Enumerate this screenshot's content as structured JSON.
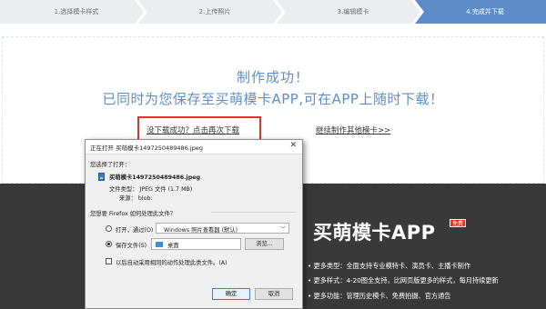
{
  "steps": [
    {
      "label": "1.选择模卡样式"
    },
    {
      "label": "2.上传照片"
    },
    {
      "label": "3.编辑模卡"
    },
    {
      "label": "4.完成并下载"
    }
  ],
  "success": {
    "title": "制作成功！",
    "subtitle": "已同时为您保存至买萌模卡APP,可在APP上随时下载！",
    "redownload_link": "没下载成功？点击再次下载",
    "continue_link": "继续制作其他模卡>>"
  },
  "promo": {
    "app_title": "买萌模卡APP",
    "badge": "免费",
    "features": [
      "• 更多类型：全面支持专业模特卡、演员卡、主播卡制作",
      "• 更多样式：4-20图全支持，比网页版更多的样式，每月持续更新",
      "• 更多功能：管理历史模卡、免费拍摄、官方通告"
    ]
  },
  "dialog": {
    "title": "正在打开 买萌模卡1497250489486.jpeg",
    "close_glyph": "✕",
    "chosen_label": "您选择了打开：",
    "file_name": "买萌模卡1497250489486.jpeg",
    "file_type": "文件类型：  JPEG 文件 (1.7 MB)",
    "source": "来源：  blob:",
    "question": "您想要 Firefox 如何处理此文件？",
    "open_with_label": "打开，通过(O)",
    "open_with_app": "Windows 照片查看器 (默认)",
    "save_file_label": "保存文件(S)",
    "save_folder": "桌面",
    "browse_button": "浏览...",
    "auto_checkbox_label": "以后自动采用相同的动作处理此类文件。(A)",
    "ok_button": "确定",
    "cancel_button": "取消",
    "selected_option": "保存文件(S)"
  },
  "colors": {
    "accent": "#5d8dc6",
    "highlight_border": "#e2322d",
    "promo_bg": "#393939",
    "badge": "#e3302d"
  },
  "icons": {
    "close": "close-icon",
    "file": "file-icon",
    "folder": "folder-icon",
    "dropdown": "chevron-down-icon"
  }
}
